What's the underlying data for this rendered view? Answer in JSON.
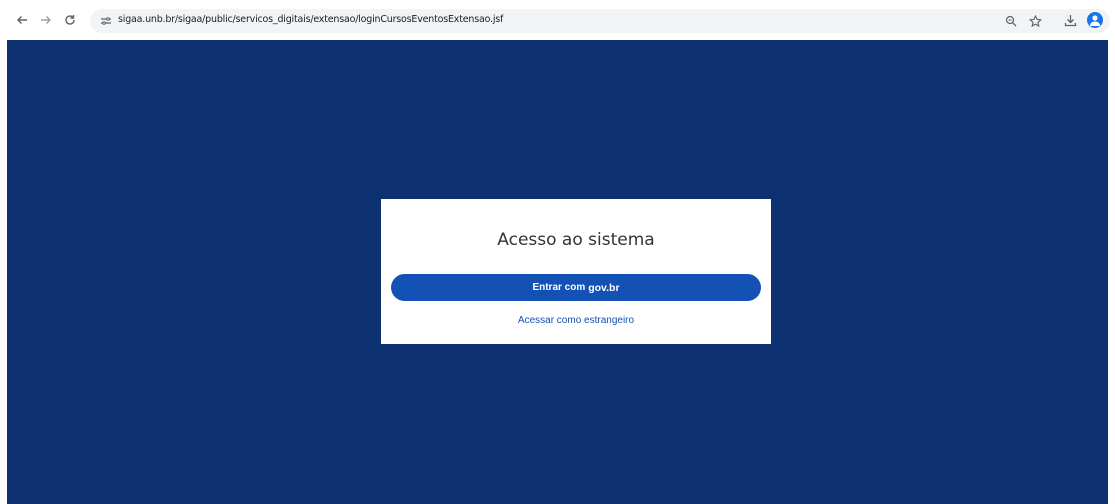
{
  "browser": {
    "url": "sigaa.unb.br/sigaa/public/servicos_digitais/extensao/loginCursosEventosExtensao.jsf",
    "icons": {
      "back": "arrow-left-icon",
      "forward": "arrow-right-icon",
      "reload": "reload-icon",
      "site_info": "tune-icon",
      "zoom": "zoom-icon",
      "bookmark": "star-icon",
      "download": "download-icon",
      "profile": "profile-icon"
    }
  },
  "login_card": {
    "title": "Acesso ao sistema",
    "govbr_button_prefix": "Entrar com",
    "govbr_button_brand": "gov.br",
    "foreign_link": "Acessar como estrangeiro"
  },
  "colors": {
    "page_background": "#0d3170",
    "card_background": "#ffffff",
    "govbr_button": "#1351b4",
    "link": "#1351b4"
  }
}
